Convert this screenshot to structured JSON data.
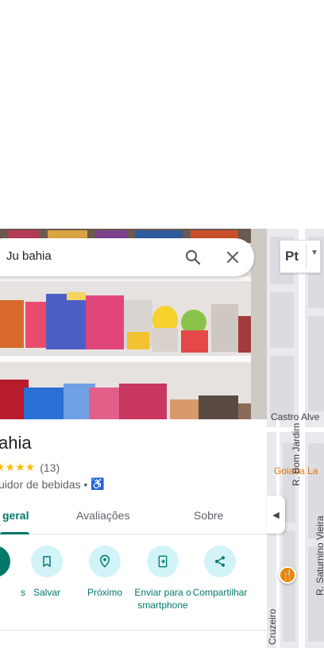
{
  "search": {
    "query": "Ju bahia"
  },
  "place": {
    "title": "ahia",
    "rating": "★★★★",
    "review_count": "(13)",
    "category": "uidor de bebidas •"
  },
  "tabs": [
    {
      "label": "geral",
      "active": true
    },
    {
      "label": "Avaliações",
      "active": false
    },
    {
      "label": "Sobre",
      "active": false
    }
  ],
  "actions": [
    {
      "label": "s",
      "icon": "directions-icon"
    },
    {
      "label": "Salvar",
      "icon": "bookmark-icon"
    },
    {
      "label": "Próximo",
      "icon": "nearby-icon"
    },
    {
      "label": "Enviar para o smartphone",
      "icon": "send-to-phone-icon"
    },
    {
      "label": "Compartilhar",
      "icon": "share-icon"
    }
  ],
  "map": {
    "language_label": "Pt",
    "labels": {
      "castro": "Castro Alve",
      "goiaba": "Goiaba La",
      "bom_jardim": "R. Bom Jardim",
      "saturnino": "R. Saturnino Vieira",
      "cruzeiro": "Cruzeiro"
    }
  },
  "colors": {
    "accent": "#00796b",
    "star": "#fbbc04",
    "action_bg": "#d2f4f9",
    "map_poi": "#e8710a"
  }
}
